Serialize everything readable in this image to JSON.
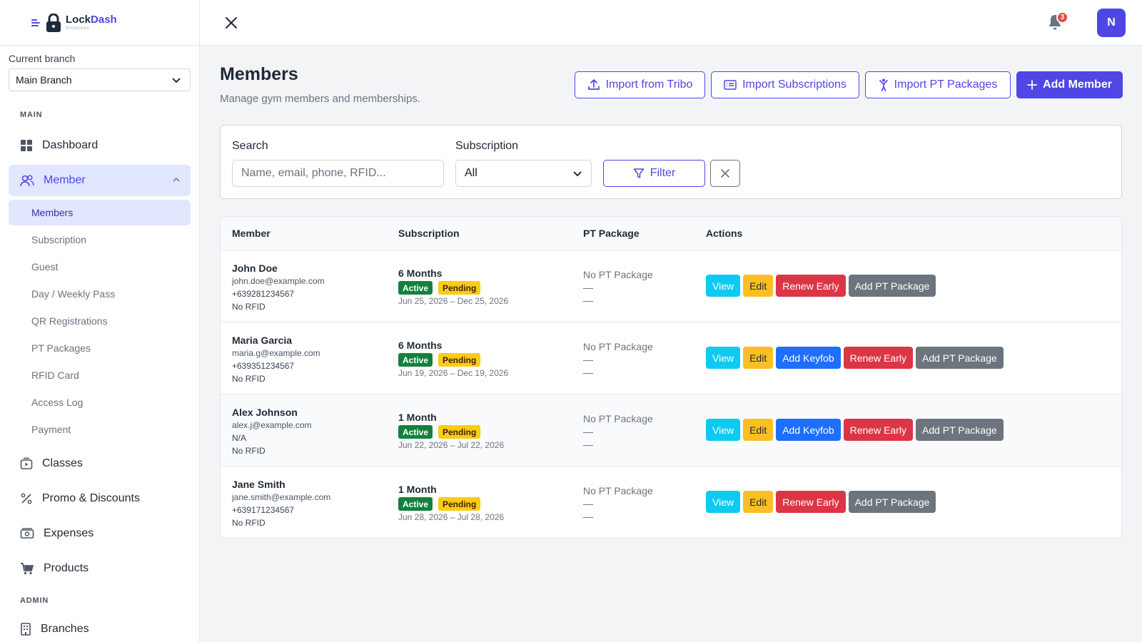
{
  "brand": {
    "name_part1": "Lock",
    "name_part2": "Dash",
    "subtitle": "Solutions"
  },
  "branch": {
    "label": "Current branch",
    "value": "Main Branch"
  },
  "sidebar": {
    "main_title": "MAIN",
    "admin_title": "ADMIN",
    "dashboard": "Dashboard",
    "member": "Member",
    "sub_items": [
      "Members",
      "Subscription",
      "Guest",
      "Day / Weekly Pass",
      "QR Registrations",
      "PT Packages",
      "RFID Card",
      "Access Log",
      "Payment"
    ],
    "classes": "Classes",
    "promo": "Promo & Discounts",
    "expenses": "Expenses",
    "products": "Products",
    "branches": "Branches"
  },
  "topbar": {
    "notification_count": "3",
    "avatar_initial": "N"
  },
  "header": {
    "title": "Members",
    "subtitle": "Manage gym members and memberships.",
    "import_tribo": "Import from Tribo",
    "import_subscriptions": "Import Subscriptions",
    "import_pt": "Import PT Packages",
    "add_member": "Add Member"
  },
  "filters": {
    "search_label": "Search",
    "search_placeholder": "Name, email, phone, RFID...",
    "subscription_label": "Subscription",
    "subscription_value": "All",
    "filter_button": "Filter"
  },
  "table": {
    "columns": [
      "Member",
      "Subscription",
      "PT Package",
      "Actions"
    ],
    "rows": [
      {
        "name": "John Doe",
        "email": "john.doe@example.com",
        "phone": "+639281234567",
        "rfid": "No RFID",
        "plan": "6 Months",
        "status1": "Active",
        "status2": "Pending",
        "range": "Jun 25, 2026 – Dec 25, 2026",
        "pt": "No PT Package",
        "pt2": "—",
        "pt3": "—",
        "actions": [
          "View",
          "Edit",
          "Renew Early",
          "Add PT Package"
        ]
      },
      {
        "name": "Maria Garcia",
        "email": "maria.g@example.com",
        "phone": "+639351234567",
        "rfid": "No RFID",
        "plan": "6 Months",
        "status1": "Active",
        "status2": "Pending",
        "range": "Jun 19, 2026 – Dec 19, 2026",
        "pt": "No PT Package",
        "pt2": "—",
        "pt3": "—",
        "actions": [
          "View",
          "Edit",
          "Add Keyfob",
          "Renew Early",
          "Add PT Package"
        ]
      },
      {
        "name": "Alex Johnson",
        "email": "alex.j@example.com",
        "phone": "N/A",
        "rfid": "No RFID",
        "plan": "1 Month",
        "status1": "Active",
        "status2": "Pending",
        "range": "Jun 22, 2026 – Jul 22, 2026",
        "pt": "No PT Package",
        "pt2": "—",
        "pt3": "—",
        "actions": [
          "View",
          "Edit",
          "Add Keyfob",
          "Renew Early",
          "Add PT Package"
        ]
      },
      {
        "name": "Jane Smith",
        "email": "jane.smith@example.com",
        "phone": "+639171234567",
        "rfid": "No RFID",
        "plan": "1 Month",
        "status1": "Active",
        "status2": "Pending",
        "range": "Jun 28, 2026 – Jul 28, 2026",
        "pt": "No PT Package",
        "pt2": "—",
        "pt3": "—",
        "actions": [
          "View",
          "Edit",
          "Renew Early",
          "Add PT Package"
        ]
      }
    ]
  },
  "colors": {
    "accent": "#4f46e5",
    "view": "#0dcaf0",
    "edit": "#fbbf24",
    "keyfob": "#1d6ffd",
    "renew": "#dc3545",
    "pt": "#6c757d",
    "active": "#15803d",
    "pending": "#facc15"
  }
}
